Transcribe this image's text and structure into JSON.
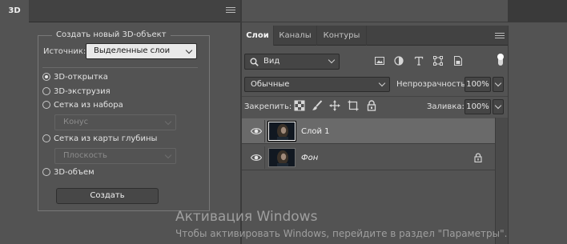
{
  "panel_3d": {
    "tab_label": "3D",
    "group_title": "Создать новый 3D-объект",
    "source_label": "Источник:",
    "source_value": "Выделенные слои",
    "options": [
      {
        "label": "3D-открытка",
        "checked": true
      },
      {
        "label": "3D-экструзия",
        "checked": false
      },
      {
        "label": "Сетка из набора",
        "checked": false
      },
      {
        "label": "Сетка из карты глубины",
        "checked": false
      },
      {
        "label": "3D-объем",
        "checked": false
      }
    ],
    "mesh_preset_value": "Конус",
    "depth_map_value": "Плоскость",
    "create_button": "Создать"
  },
  "layers_panel": {
    "tabs": [
      {
        "label": "Слои",
        "active": true
      },
      {
        "label": "Каналы",
        "active": false
      },
      {
        "label": "Контуры",
        "active": false
      }
    ],
    "filter_kind": "Вид",
    "filter_icons": [
      "image-filter-icon",
      "adjustment-filter-icon",
      "type-filter-icon",
      "shape-filter-icon",
      "smart-object-filter-icon"
    ],
    "blend_mode": "Обычные",
    "opacity_label": "Непрозрачность:",
    "opacity_value": "100%",
    "lock_label": "Закрепить:",
    "lock_icons": [
      "lock-transparent-pixels-icon",
      "lock-image-pixels-icon",
      "lock-position-icon",
      "prevent-auto-nesting-icon",
      "lock-all-icon"
    ],
    "fill_label": "Заливка:",
    "fill_value": "100%",
    "layers": [
      {
        "name": "Слой 1",
        "selected": true,
        "locked": false,
        "italic": false
      },
      {
        "name": "Фон",
        "selected": false,
        "locked": true,
        "italic": true
      }
    ]
  },
  "watermark": {
    "title": "Активация Windows",
    "text": "Чтобы активировать Windows, перейдите в раздел \"Параметры\"."
  },
  "colors": {
    "panel_bg": "#535353",
    "tab_bar_bg": "#424242",
    "selected_layer_bg": "#6a6a6a"
  }
}
